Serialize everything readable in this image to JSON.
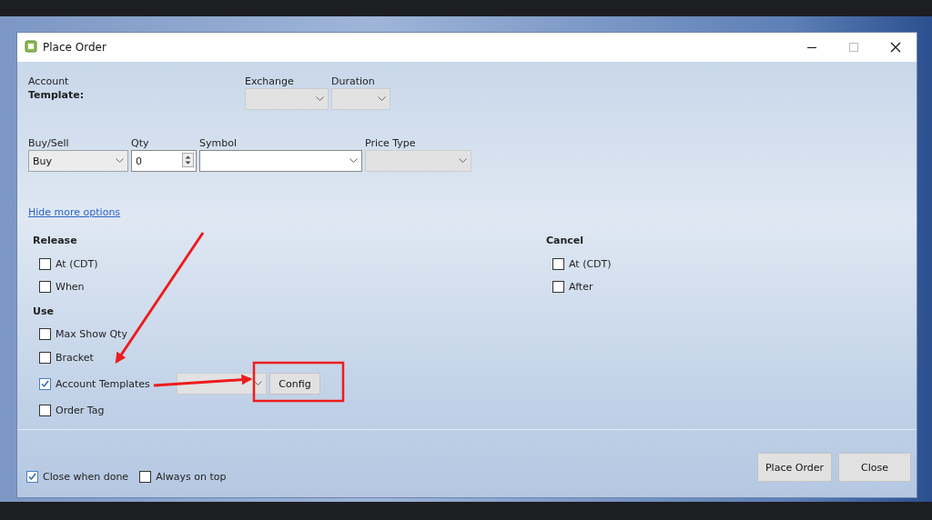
{
  "window": {
    "title": "Place Order"
  },
  "header": {
    "account_label": "Account",
    "template_label": "Template:",
    "exchange": {
      "label": "Exchange"
    },
    "duration": {
      "label": "Duration"
    }
  },
  "order_row": [
    {
      "kind": "combo",
      "label": "Buy/Sell",
      "value": "Buy",
      "enabled": true
    },
    {
      "kind": "spin",
      "label": "Qty",
      "value": "0"
    },
    {
      "kind": "combo",
      "label": "Symbol",
      "enabled": true
    },
    {
      "kind": "combo",
      "label": "Price Type",
      "enabled": false
    }
  ],
  "options_link": "Hide more options",
  "release": {
    "title": "Release",
    "options": [
      {
        "label": "At (CDT)",
        "checked": false
      },
      {
        "label": "When",
        "checked": false
      }
    ]
  },
  "cancel": {
    "title": "Cancel",
    "options": [
      {
        "label": "At (CDT)",
        "checked": false
      },
      {
        "label": "After",
        "checked": false
      }
    ]
  },
  "use": {
    "title": "Use",
    "options": [
      {
        "label": "Max Show Qty",
        "checked": false
      },
      {
        "label": "Bracket",
        "checked": false
      },
      {
        "label": "Account Templates",
        "checked": true,
        "config_button": "Config"
      },
      {
        "label": "Order Tag",
        "checked": false
      }
    ]
  },
  "footer": {
    "options": [
      {
        "label": "Close when done",
        "checked": true
      },
      {
        "label": "Always on top",
        "checked": false
      }
    ],
    "buttons": [
      "Place Order",
      "Close"
    ]
  },
  "annotations": [
    {
      "kind": "arrow"
    },
    {
      "kind": "arrow"
    },
    {
      "kind": "highlight"
    }
  ]
}
